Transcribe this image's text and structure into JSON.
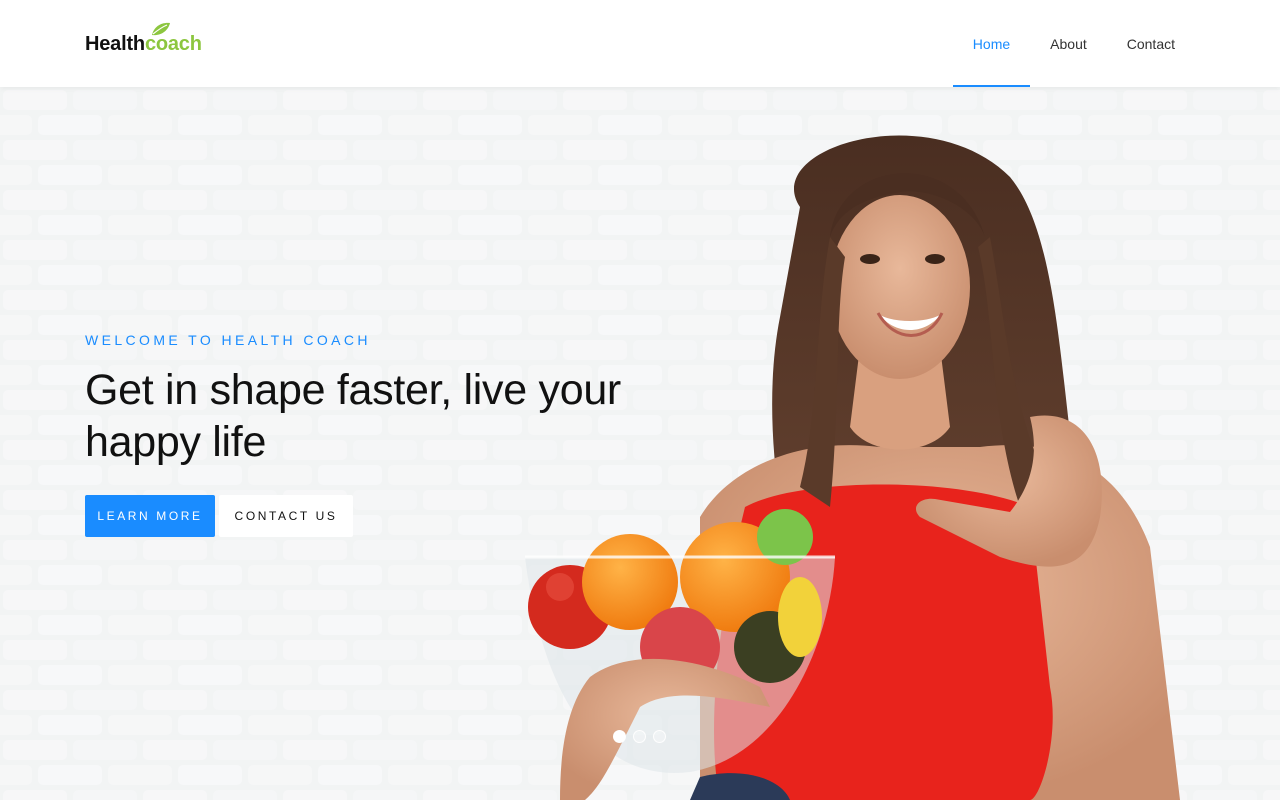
{
  "header": {
    "logo": {
      "word1": "Health",
      "word2": "coach"
    },
    "nav": [
      {
        "label": "Home",
        "active": true
      },
      {
        "label": "About",
        "active": false
      },
      {
        "label": "Contact",
        "active": false
      }
    ]
  },
  "hero": {
    "eyebrow": "WELCOME TO HEALTH COACH",
    "headline_line1": "Get in shape faster, live your",
    "headline_line2": "happy life",
    "primary_button": "LEARN MORE",
    "secondary_button": "CONTACT US",
    "image_icon": "woman-with-fruit-bowl-photo",
    "slider": {
      "count": 3,
      "active_index": 0
    }
  },
  "colors": {
    "accent": "#1a8cff",
    "logo_green": "#8cc63f",
    "text_dark": "#111111",
    "top_red": "#e8231c"
  }
}
